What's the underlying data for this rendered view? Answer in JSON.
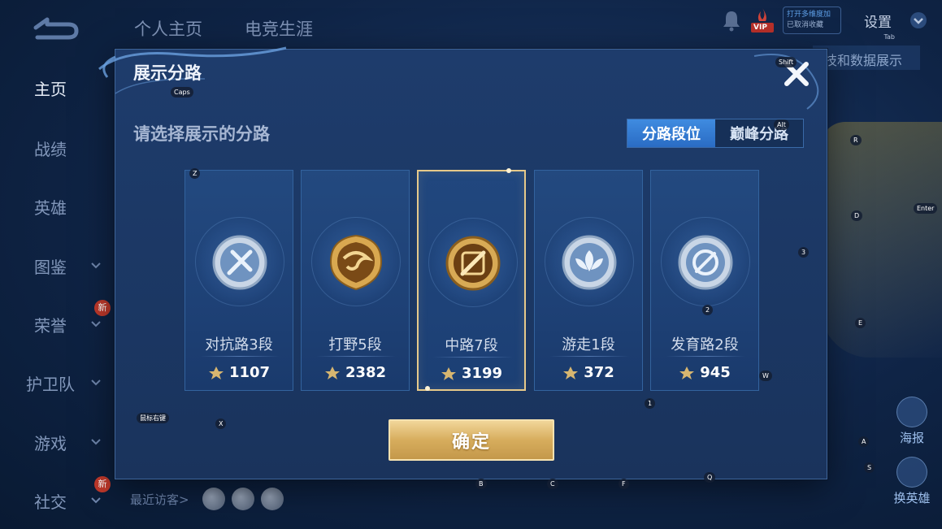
{
  "top_tabs": [
    "个人主页",
    "电竞生涯"
  ],
  "top_right": {
    "vip_label": "VIP",
    "fw_line1": "打开多维度加",
    "fw_line2": "已取消收藏",
    "settings_label": "设置",
    "settings_key": "Tab"
  },
  "bg_right_label": "技和数据展示",
  "sidebar": {
    "items": [
      {
        "label": "主页"
      },
      {
        "label": "战绩"
      },
      {
        "label": "英雄"
      },
      {
        "label": "图鉴"
      },
      {
        "label": "荣誉",
        "badge": "新"
      },
      {
        "label": "护卫队"
      },
      {
        "label": "游戏"
      },
      {
        "label": "社交",
        "badge": "新"
      }
    ]
  },
  "visitors_label": "最近访客>",
  "right_buttons": {
    "poster": "海报",
    "switch_hero": "换英雄"
  },
  "modal": {
    "title": "展示分路",
    "subtitle": "请选择展示的分路",
    "toggle": {
      "option1": "分路段位",
      "option2": "巅峰分路",
      "active": "分路段位"
    },
    "cards": [
      {
        "name": "对抗路3段",
        "score": "1107",
        "emblem": "clash-lane-emblem",
        "selected": false
      },
      {
        "name": "打野5段",
        "score": "2382",
        "emblem": "jungle-emblem",
        "selected": false
      },
      {
        "name": "中路7段",
        "score": "3199",
        "emblem": "mid-lane-emblem",
        "selected": true
      },
      {
        "name": "游走1段",
        "score": "372",
        "emblem": "roam-emblem",
        "selected": false
      },
      {
        "name": "发育路2段",
        "score": "945",
        "emblem": "farm-lane-emblem",
        "selected": false
      }
    ],
    "confirm_label": "确定"
  },
  "key_hints": {
    "shift": "Shift",
    "caps": "Caps",
    "alt": "Alt",
    "z": "Z",
    "r": "R",
    "enter": "Enter",
    "d": "D",
    "three": "3",
    "two": "2",
    "e": "E",
    "w": "W",
    "one": "1",
    "x": "X",
    "hold": "鼠标右键",
    "a": "A",
    "s": "S",
    "b": "B",
    "c": "C",
    "f": "F",
    "q": "Q"
  },
  "colors": {
    "accent_blue": "#2a6cc4",
    "gold": "#d7ad5d",
    "selected_border": "#e6c98a",
    "badge_red": "#c0392b"
  }
}
